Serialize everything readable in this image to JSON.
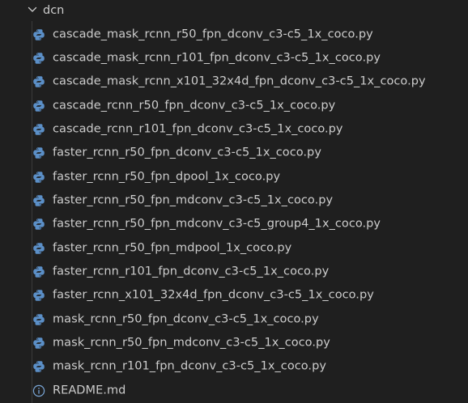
{
  "folder": {
    "name": "dcn",
    "expanded": true,
    "chevron_icon": "chevron-down-icon"
  },
  "colors": {
    "background": "#1f1f1f",
    "text": "#cccccc",
    "python_icon": "#5b8fc7",
    "info_icon": "#7aa6d6",
    "tree_guide": "#3b3b3b"
  },
  "files": [
    {
      "name": "cascade_mask_rcnn_r50_fpn_dconv_c3-c5_1x_coco.py",
      "icon": "python-icon"
    },
    {
      "name": "cascade_mask_rcnn_r101_fpn_dconv_c3-c5_1x_coco.py",
      "icon": "python-icon"
    },
    {
      "name": "cascade_mask_rcnn_x101_32x4d_fpn_dconv_c3-c5_1x_coco.py",
      "icon": "python-icon"
    },
    {
      "name": "cascade_rcnn_r50_fpn_dconv_c3-c5_1x_coco.py",
      "icon": "python-icon"
    },
    {
      "name": "cascade_rcnn_r101_fpn_dconv_c3-c5_1x_coco.py",
      "icon": "python-icon"
    },
    {
      "name": "faster_rcnn_r50_fpn_dconv_c3-c5_1x_coco.py",
      "icon": "python-icon"
    },
    {
      "name": "faster_rcnn_r50_fpn_dpool_1x_coco.py",
      "icon": "python-icon"
    },
    {
      "name": "faster_rcnn_r50_fpn_mdconv_c3-c5_1x_coco.py",
      "icon": "python-icon"
    },
    {
      "name": "faster_rcnn_r50_fpn_mdconv_c3-c5_group4_1x_coco.py",
      "icon": "python-icon"
    },
    {
      "name": "faster_rcnn_r50_fpn_mdpool_1x_coco.py",
      "icon": "python-icon"
    },
    {
      "name": "faster_rcnn_r101_fpn_dconv_c3-c5_1x_coco.py",
      "icon": "python-icon"
    },
    {
      "name": "faster_rcnn_x101_32x4d_fpn_dconv_c3-c5_1x_coco.py",
      "icon": "python-icon"
    },
    {
      "name": "mask_rcnn_r50_fpn_dconv_c3-c5_1x_coco.py",
      "icon": "python-icon"
    },
    {
      "name": "mask_rcnn_r50_fpn_mdconv_c3-c5_1x_coco.py",
      "icon": "python-icon"
    },
    {
      "name": "mask_rcnn_r101_fpn_dconv_c3-c5_1x_coco.py",
      "icon": "python-icon"
    },
    {
      "name": "README.md",
      "icon": "info-icon"
    }
  ]
}
